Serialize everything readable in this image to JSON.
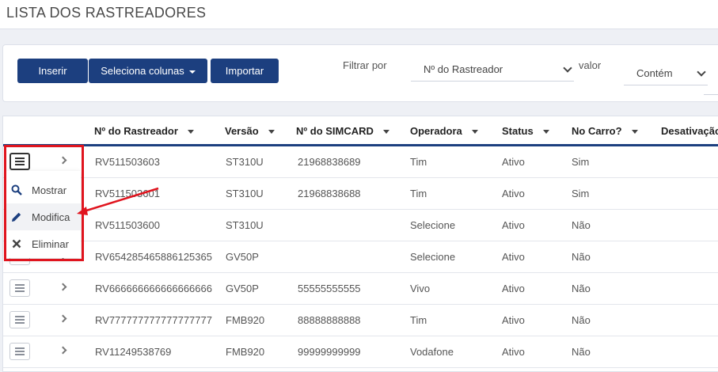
{
  "page": {
    "title": "LISTA DOS RASTREADORES"
  },
  "toolbar": {
    "insert_label": "Inserir",
    "columns_label": "Seleciona colunas",
    "import_label": "Importar",
    "filter_label": "Filtrar por",
    "filter_field": "Nº do Rastreador",
    "value_label": "valor",
    "operator": "Contém"
  },
  "table": {
    "columns": [
      "Nº do Rastreador",
      "Versão",
      "Nº do SIMCARD",
      "Operadora",
      "Status",
      "No Carro?",
      "Desativação"
    ],
    "rows": [
      {
        "tracker": "RV511503603",
        "version": "ST310U",
        "simcard": "21968838689",
        "operator": "Tim",
        "status": "Ativo",
        "in_car": "Sim"
      },
      {
        "tracker": "RV511503601",
        "version": "ST310U",
        "simcard": "21968838688",
        "operator": "Tim",
        "status": "Ativo",
        "in_car": "Sim"
      },
      {
        "tracker": "RV511503600",
        "version": "ST310U",
        "simcard": "",
        "operator": "Selecione",
        "status": "Ativo",
        "in_car": "Não"
      },
      {
        "tracker": "RV654285465886125365",
        "version": "GV50P",
        "simcard": "",
        "operator": "Selecione",
        "status": "Ativo",
        "in_car": "Não"
      },
      {
        "tracker": "RV666666666666666666",
        "version": "GV50P",
        "simcard": "55555555555",
        "operator": "Vivo",
        "status": "Ativo",
        "in_car": "Não"
      },
      {
        "tracker": "RV777777777777777777",
        "version": "FMB920",
        "simcard": "88888888888",
        "operator": "Tim",
        "status": "Ativo",
        "in_car": "Não"
      },
      {
        "tracker": "RV11249538769",
        "version": "FMB920",
        "simcard": "99999999999",
        "operator": "Vodafone",
        "status": "Ativo",
        "in_car": "Não"
      }
    ]
  },
  "row_menu": {
    "items": [
      {
        "label": "Mostrar",
        "icon": "search-icon"
      },
      {
        "label": "Modifica",
        "icon": "pencil-icon"
      },
      {
        "label": "Eliminar",
        "icon": "close-icon"
      }
    ]
  },
  "colors": {
    "primary": "#1c3f7f",
    "annotation": "#e0141e"
  }
}
